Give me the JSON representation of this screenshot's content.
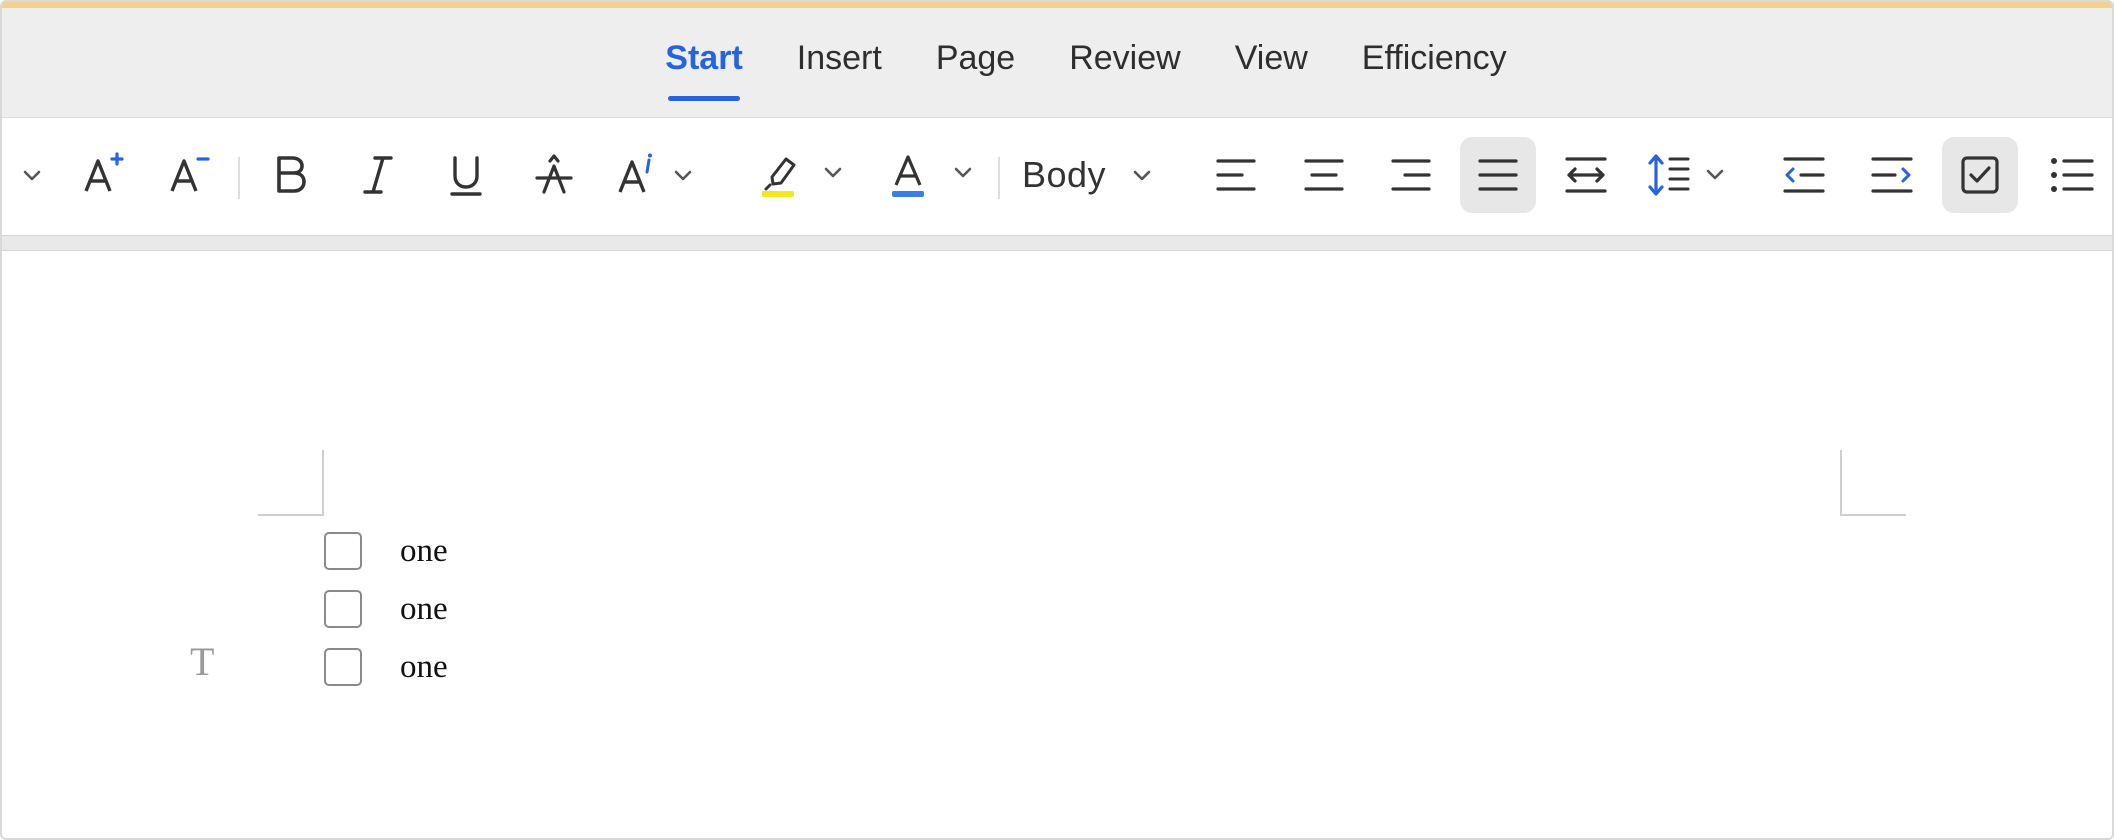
{
  "tabs": [
    {
      "label": "Start",
      "active": true
    },
    {
      "label": "Insert",
      "active": false
    },
    {
      "label": "Page",
      "active": false
    },
    {
      "label": "Review",
      "active": false
    },
    {
      "label": "View",
      "active": false
    },
    {
      "label": "Efficiency",
      "active": false
    }
  ],
  "toolbar": {
    "paragraph_style": "Body",
    "icons": [
      "chevron-down-icon",
      "increase-font-size-icon",
      "decrease-font-size-icon",
      "bold-icon",
      "italic-icon",
      "underline-icon",
      "strikethrough-icon",
      "text-effects-icon",
      "highlight-icon",
      "font-color-icon",
      "align-left-icon",
      "align-center-icon",
      "align-right-icon",
      "justify-icon",
      "distributed-icon",
      "line-spacing-icon",
      "decrease-indent-icon",
      "increase-indent-icon",
      "checklist-icon",
      "bullet-list-icon"
    ],
    "selected": [
      "justify-icon",
      "checklist-icon"
    ]
  },
  "colors": {
    "accent_blue": "#2563e0",
    "highlight_yellow": "#f6e71a",
    "font_color_blue": "#3b7de8",
    "top_accent_line": "#f5cf8d"
  },
  "document": {
    "todo_items": [
      {
        "text": "one",
        "checked": false
      },
      {
        "text": "one",
        "checked": false
      },
      {
        "text": "one",
        "checked": false
      }
    ],
    "text_marker": "T"
  }
}
